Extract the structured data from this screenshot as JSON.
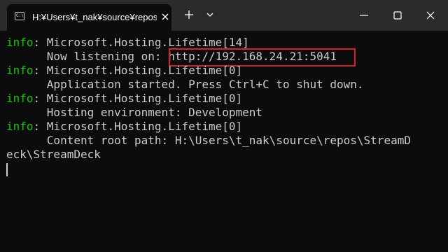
{
  "window": {
    "tab_title": "H:¥Users¥t_nak¥source¥repos",
    "tab_icon_text": "C:\\"
  },
  "colors": {
    "background": "#0c0c0c",
    "titlebar": "#2b2b2b",
    "text": "#cccccc",
    "info_level": "#16c60c",
    "highlight_box": "#d6202b"
  },
  "icons": {
    "tab": "terminal-icon",
    "tab_close": "close-icon",
    "new_tab": "plus-icon",
    "dropdown": "chevron-down-icon",
    "minimize": "minimize-icon",
    "maximize": "maximize-icon",
    "close": "close-icon"
  },
  "console": {
    "lines": [
      {
        "level": "info",
        "text": ": Microsoft.Hosting.Lifetime[14]"
      },
      {
        "prefix": "      Now listening on: ",
        "url": "http://192.168.24.21:5041"
      },
      {
        "level": "info",
        "text": ": Microsoft.Hosting.Lifetime[0]"
      },
      {
        "text": "      Application started. Press Ctrl+C to shut down."
      },
      {
        "level": "info",
        "text": ": Microsoft.Hosting.Lifetime[0]"
      },
      {
        "text": "      Hosting environment: Development"
      },
      {
        "level": "info",
        "text": ": Microsoft.Hosting.Lifetime[0]"
      },
      {
        "text": "      Content root path: H:\\Users\\t_nak\\source\\repos\\StreamD"
      },
      {
        "text": "eck\\StreamDeck"
      }
    ]
  }
}
